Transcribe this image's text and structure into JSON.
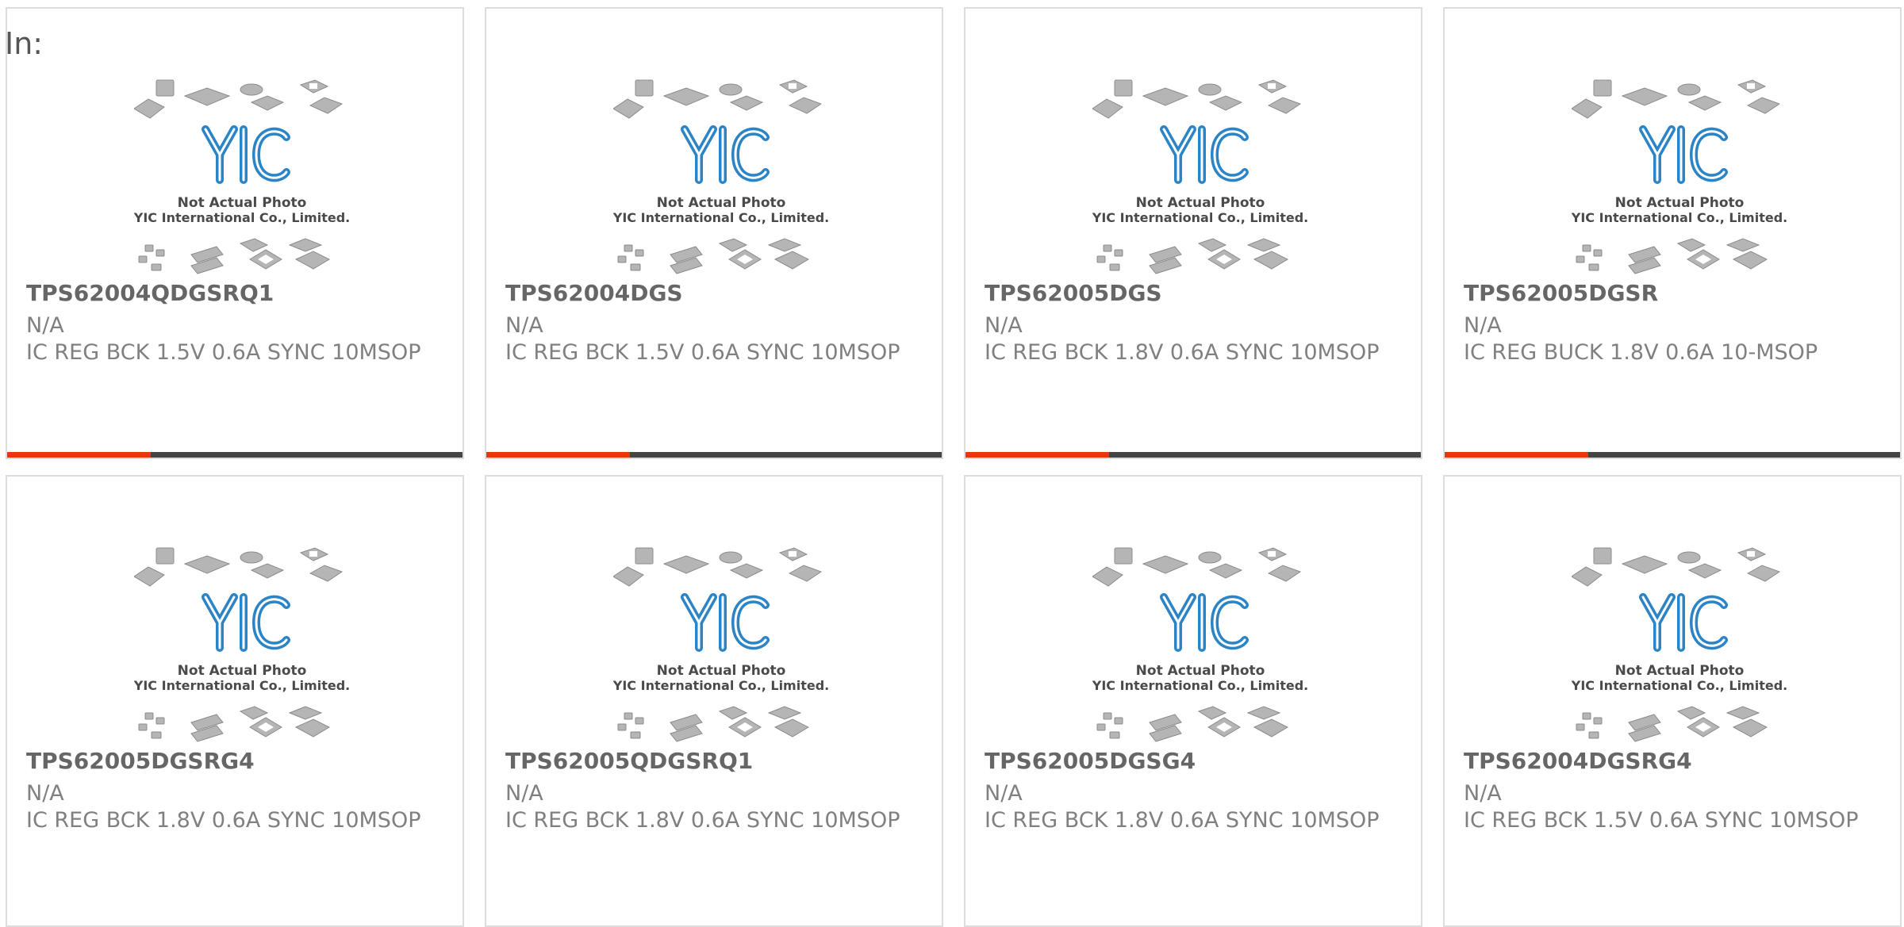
{
  "filter_prefix": "In:",
  "accent_color": "#e8360f",
  "track_color": "#444444",
  "placeholder": {
    "logo_text": "YIC",
    "line1": "Not Actual Photo",
    "line2": "YIC International Co., Limited."
  },
  "products": [
    {
      "part_number": "TPS62004QDGSRQ1",
      "manufacturer": "N/A",
      "description": "IC REG BCK 1.5V 0.6A SYNC 10MSOP",
      "progress": 0.315
    },
    {
      "part_number": "TPS62004DGS",
      "manufacturer": "N/A",
      "description": "IC REG BCK 1.5V 0.6A SYNC 10MSOP",
      "progress": 0.315
    },
    {
      "part_number": "TPS62005DGS",
      "manufacturer": "N/A",
      "description": "IC REG BCK 1.8V 0.6A SYNC 10MSOP",
      "progress": 0.315
    },
    {
      "part_number": "TPS62005DGSR",
      "manufacturer": "N/A",
      "description": "IC REG BUCK 1.8V 0.6A 10-MSOP",
      "progress": 0.315
    },
    {
      "part_number": "TPS62005DGSRG4",
      "manufacturer": "N/A",
      "description": "IC REG BCK 1.8V 0.6A SYNC 10MSOP",
      "progress": null
    },
    {
      "part_number": "TPS62005QDGSRQ1",
      "manufacturer": "N/A",
      "description": "IC REG BCK 1.8V 0.6A SYNC 10MSOP",
      "progress": null
    },
    {
      "part_number": "TPS62005DGSG4",
      "manufacturer": "N/A",
      "description": "IC REG BCK 1.8V 0.6A SYNC 10MSOP",
      "progress": null
    },
    {
      "part_number": "TPS62004DGSRG4",
      "manufacturer": "N/A",
      "description": "IC REG BCK 1.5V 0.6A SYNC 10MSOP",
      "progress": null
    }
  ]
}
